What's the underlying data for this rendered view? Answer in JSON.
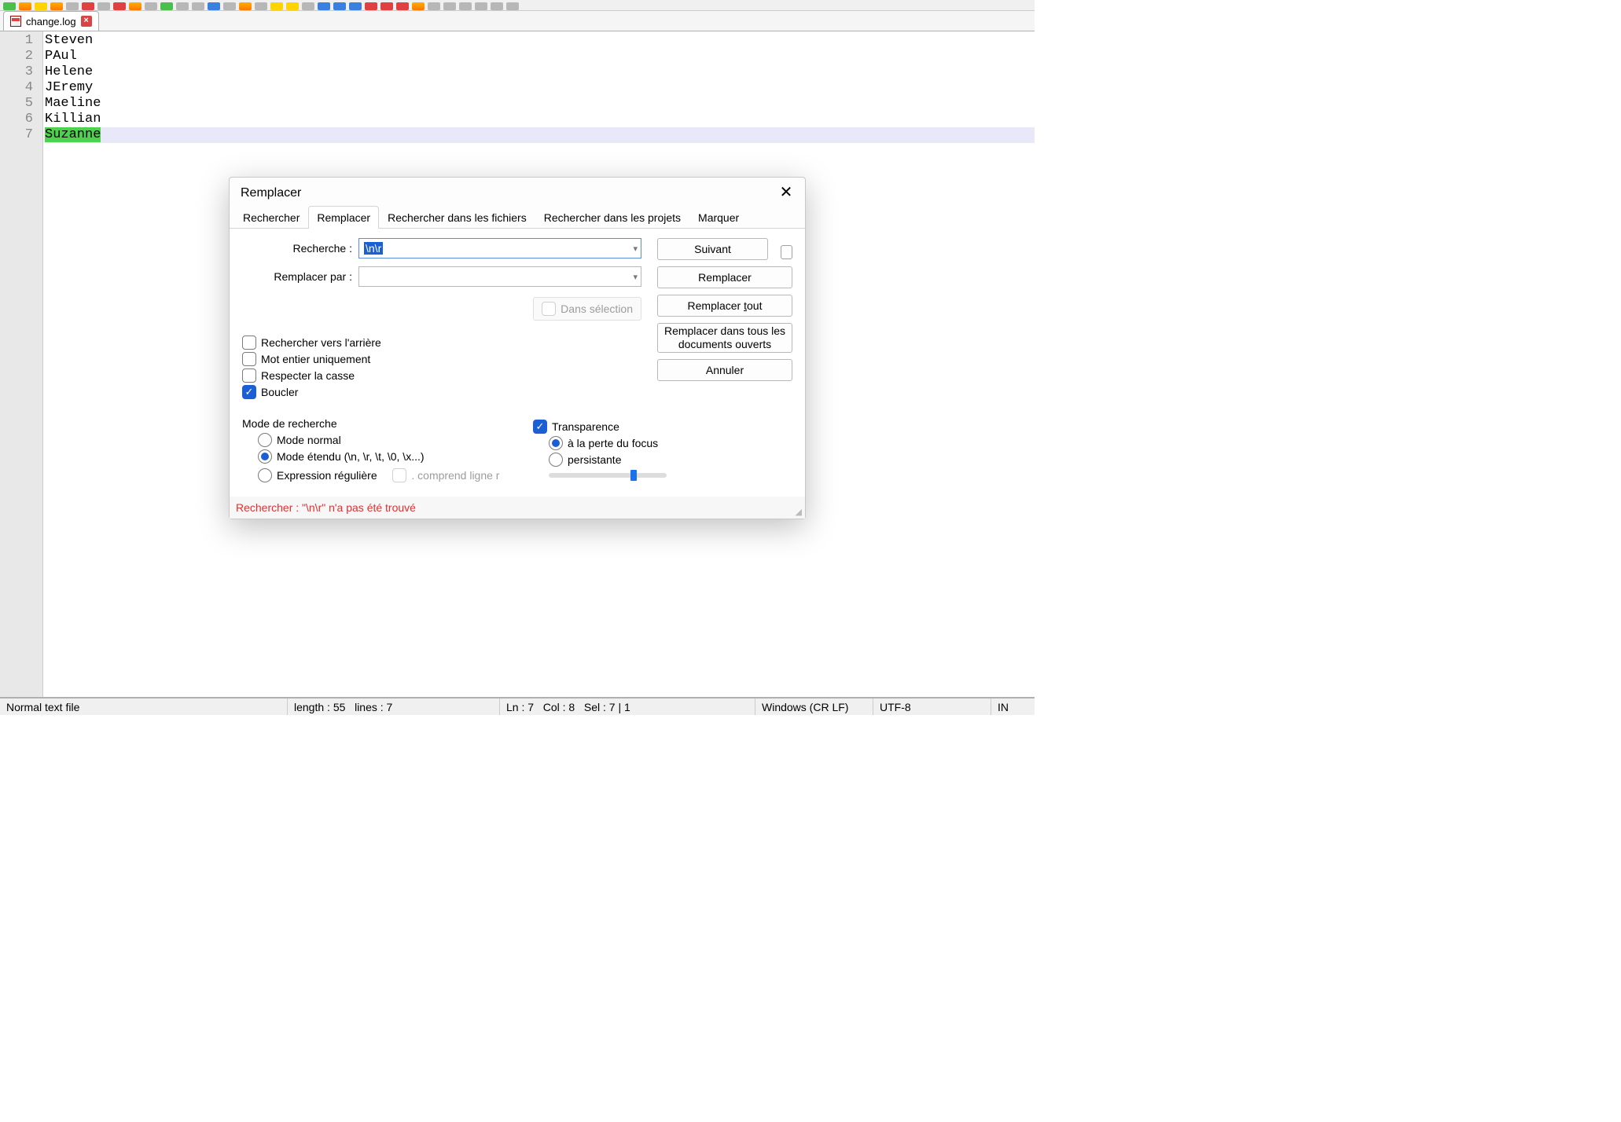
{
  "tab": {
    "filename": "change.log"
  },
  "editor": {
    "lines": [
      "Steven",
      "PAul",
      "Helene",
      "JEremy",
      "Maeline",
      "Killian",
      "Suzanne"
    ],
    "currentLineIndex": 6,
    "highlightText": "Suzanne"
  },
  "status": {
    "filetype": "Normal text file",
    "length_label": "length :",
    "length_value": "55",
    "lines_label": "lines :",
    "lines_value": "7",
    "ln_label": "Ln :",
    "ln_value": "7",
    "col_label": "Col :",
    "col_value": "8",
    "sel_label": "Sel :",
    "sel_value": "7 | 1",
    "eol": "Windows (CR LF)",
    "encoding": "UTF-8",
    "insert": "IN"
  },
  "dialog": {
    "title": "Remplacer",
    "tabs": [
      "Rechercher",
      "Remplacer",
      "Rechercher dans les fichiers",
      "Rechercher dans les projets",
      "Marquer"
    ],
    "activeTab": 1,
    "search_label": "Recherche :",
    "search_value": "\\n\\r",
    "replace_label": "Remplacer par :",
    "replace_value": "",
    "in_selection": "Dans sélection",
    "buttons": {
      "next": "Suivant",
      "replace": "Remplacer",
      "replace_all": "Remplacer tout",
      "replace_all_docs": "Remplacer dans tous les documents ouverts",
      "cancel": "Annuler"
    },
    "options": {
      "backward": "Rechercher vers l'arrière",
      "whole_word": "Mot entier uniquement",
      "match_case": "Respecter la casse",
      "wrap": "Boucler"
    },
    "search_mode": {
      "label": "Mode de recherche",
      "normal": "Mode normal",
      "extended": "Mode étendu (\\n, \\r, \\t, \\0, \\x...)",
      "regex": "Expression régulière",
      "dot_newline": ". comprend ligne r"
    },
    "transparency": {
      "label": "Transparence",
      "on_focus_loss": "à la perte du focus",
      "persistent": "persistante"
    },
    "footer_msg": "Rechercher : \"\\n\\r\" n'a pas été trouvé"
  }
}
